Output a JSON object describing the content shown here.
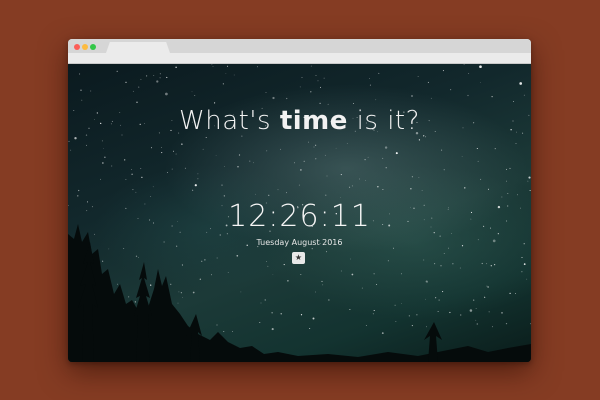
{
  "headline": {
    "before": "What's ",
    "emphasis": "time",
    "after": " is it?"
  },
  "clock": {
    "time": "12:26:11",
    "date": "Tuesday August 2016"
  },
  "favorite_button": {
    "icon": "star-icon",
    "glyph": "★"
  },
  "colors": {
    "background": "#853c23",
    "text": "#f2f2f2",
    "window_dots": [
      "#fc5d57",
      "#fdbb40",
      "#33c748"
    ]
  }
}
